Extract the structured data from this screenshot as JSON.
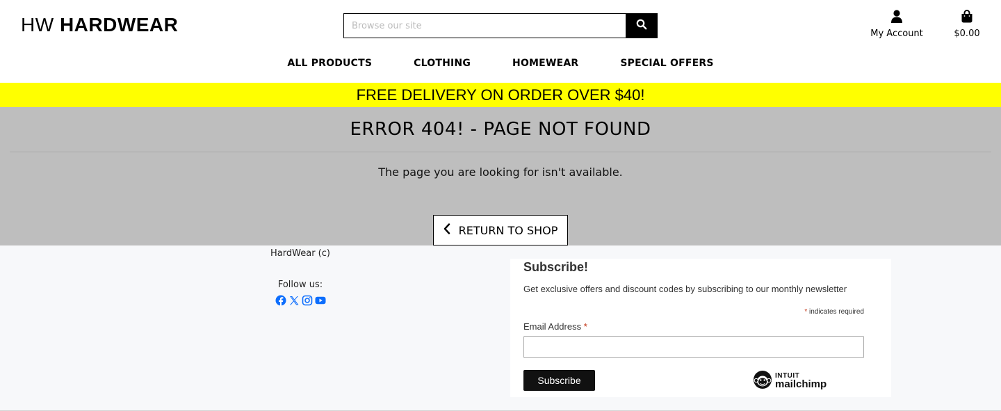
{
  "header": {
    "logo_prefix": "HW",
    "logo_main": "HARDWEAR",
    "search_placeholder": "Browse our site",
    "search_icon": "search-icon",
    "account_label": "My Account",
    "account_icon": "user-icon",
    "cart_total": "$0.00",
    "cart_icon": "shopping-bag-icon"
  },
  "nav": {
    "items": [
      "ALL PRODUCTS",
      "CLOTHING",
      "HOMEWEAR",
      "SPECIAL OFFERS"
    ]
  },
  "promo": {
    "text": "FREE DELIVERY ON ORDER OVER $40!",
    "color": "#ffff00"
  },
  "error": {
    "title": "ERROR 404! - PAGE NOT FOUND",
    "message": "The page you are looking for isn't available.",
    "return_label": "RETURN TO SHOP",
    "background": "#bebebe"
  },
  "footer": {
    "copyright": "HardWear (c)",
    "follow_label": "Follow us:",
    "social_icons": [
      "facebook-icon",
      "x-twitter-icon",
      "instagram-icon",
      "youtube-icon"
    ],
    "social_color": "#0d6efd"
  },
  "subscribe": {
    "title": "Subscribe!",
    "description": "Get exclusive offers and discount codes by subscribing to our monthly newsletter",
    "required_star": "*",
    "required_note": " indicates required",
    "email_label": "Email Address",
    "email_value": "",
    "button_label": "Subscribe",
    "brand_line1": "INTUIT",
    "brand_line2": "mailchimp"
  }
}
